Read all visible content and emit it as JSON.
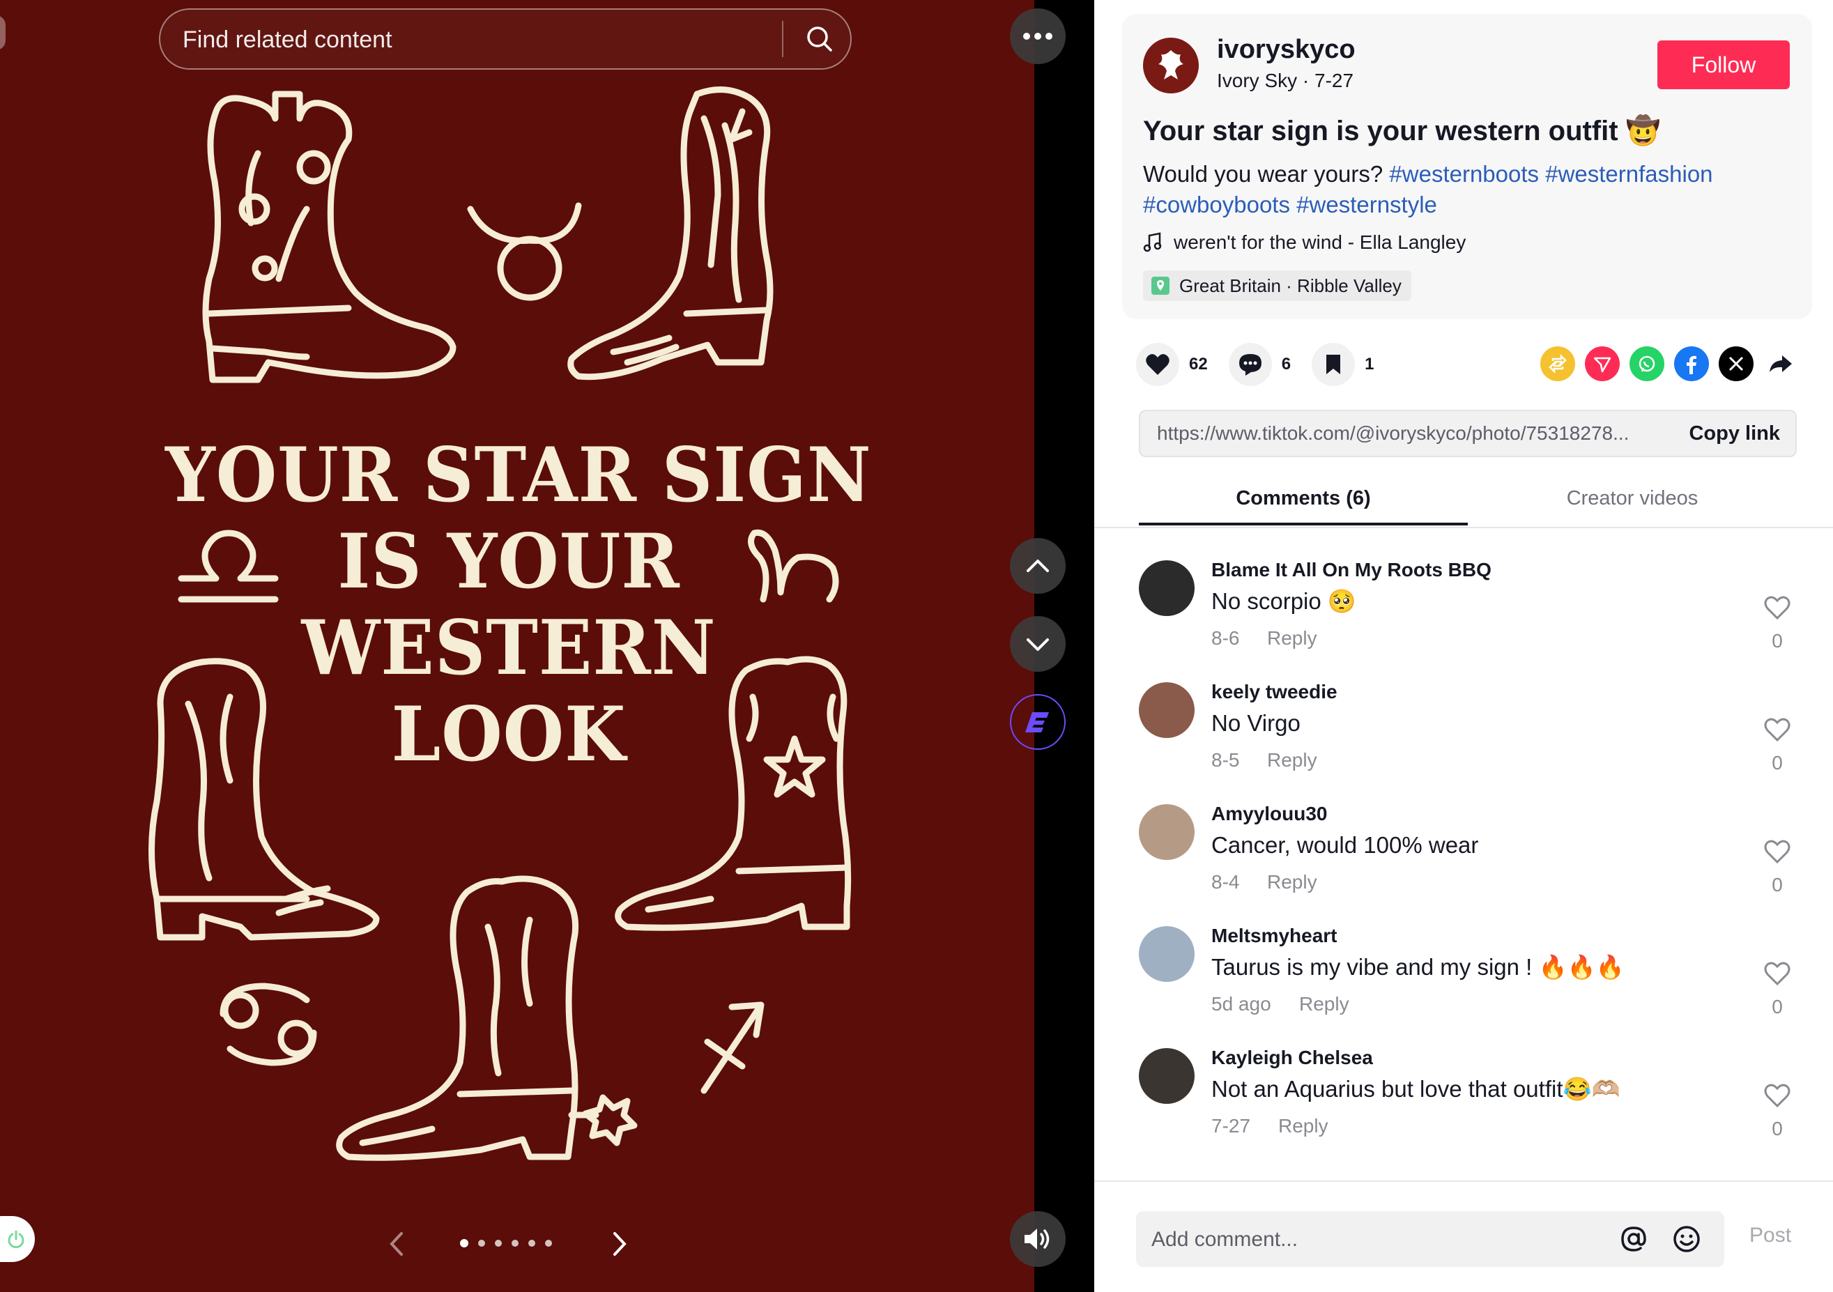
{
  "media": {
    "search_placeholder": "Find related content",
    "headline_lines": [
      "YOUR STAR SIGN",
      "IS YOUR",
      "WESTERN",
      "LOOK"
    ],
    "background_color": "#5b0d09",
    "ink_color": "#f6edd6",
    "carousel_dots": 6,
    "carousel_active_index": 0,
    "icons": [
      "more-icon",
      "search-icon",
      "chevron-up-icon",
      "chevron-down-icon",
      "e-extension-icon",
      "volume-icon",
      "power-icon",
      "chevron-left-icon",
      "chevron-right-icon"
    ]
  },
  "post": {
    "username": "ivoryskyco",
    "meta": "Ivory Sky · 7-27",
    "follow_label": "Follow",
    "title": "Your star sign is your western outfit 🤠",
    "desc_prefix": "Would you wear yours? ",
    "hashtags": [
      "#westernboots",
      "#westernfashion",
      "#cowboyboots",
      "#westernstyle"
    ],
    "music": "weren't for the wind - Ella Langley",
    "location": "Great Britain · Ribble Valley"
  },
  "actions": {
    "likes": "62",
    "comments": "6",
    "saves": "1",
    "share_targets": [
      "repost-icon",
      "send-icon",
      "whatsapp-icon",
      "facebook-icon",
      "x-icon",
      "share-arrow-icon"
    ]
  },
  "link": {
    "url": "https://www.tiktok.com/@ivoryskyco/photo/75318278...",
    "copy_label": "Copy link"
  },
  "tabs": {
    "comments": "Comments (6)",
    "creator": "Creator videos"
  },
  "comments": [
    {
      "name": "Blame It All On My Roots BBQ",
      "text": "No scorpio 🥺",
      "date": "8-6",
      "reply": "Reply",
      "likes": "0",
      "avatar_color": "#2b2b2b"
    },
    {
      "name": "keely tweedie",
      "text": "No Virgo",
      "date": "8-5",
      "reply": "Reply",
      "likes": "0",
      "avatar_color": "#8a5a4a"
    },
    {
      "name": "Amyylouu30",
      "text": "Cancer, would 100% wear",
      "date": "8-4",
      "reply": "Reply",
      "likes": "0",
      "avatar_color": "#b59a86"
    },
    {
      "name": "Meltsmyheart",
      "text": "Taurus is my vibe and my sign ! 🔥🔥🔥",
      "date": "5d ago",
      "reply": "Reply",
      "likes": "0",
      "avatar_color": "#9fb0c2"
    },
    {
      "name": "Kayleigh Chelsea",
      "text": "Not an Aquarius but love that outfit😂🫶🏼",
      "date": "7-27",
      "reply": "Reply",
      "likes": "0",
      "avatar_color": "#3a3531"
    }
  ],
  "composer": {
    "placeholder": "Add comment...",
    "post_label": "Post"
  }
}
